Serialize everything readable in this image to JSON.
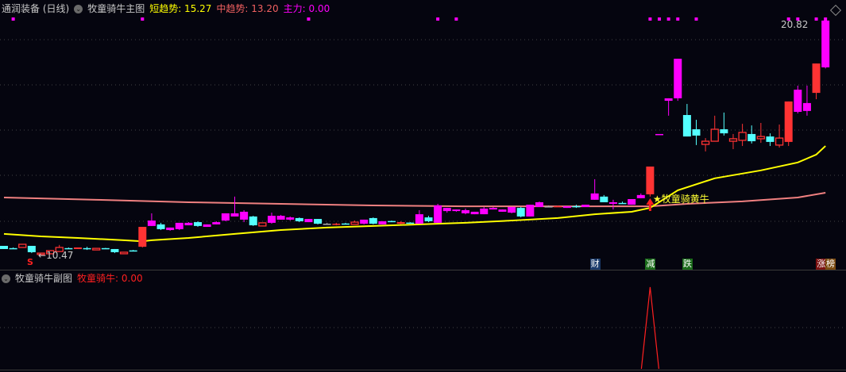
{
  "main_header": {
    "title": "通润装备 (日线)",
    "indicator": "牧童骑牛主图",
    "short_label": "短趋势: 15.27",
    "mid_label": "中趋势: 13.20",
    "main_force_label": "主力: 0.00"
  },
  "sub_header": {
    "indicator": "牧童骑牛副图",
    "value_label": "牧童骑牛: 0.00"
  },
  "annotations": {
    "high_label": "20.82",
    "low_label": "10.47",
    "signal_label": "★牧童骑黄牛",
    "s_mark": "S"
  },
  "tags": [
    {
      "text": "财",
      "index": 64,
      "bg": "#1a3a6a"
    },
    {
      "text": "减",
      "index": 70,
      "bg": "#1a6a1a"
    },
    {
      "text": "跌",
      "index": 74,
      "bg": "#1a6a1a"
    },
    {
      "text": "涨",
      "index": 88.5,
      "bg": "#7a1010"
    },
    {
      "text": "榜",
      "index": 89.5,
      "bg": "#7a4a10"
    }
  ],
  "colors": {
    "up": "#ff3333",
    "down": "#54ffff",
    "hot": "#ff00ff",
    "short_trend": "#ffff00",
    "mid_trend": "#f08080",
    "signal": "#ff2020"
  },
  "chart_data": {
    "type": "candlestick",
    "price_range": [
      10.47,
      20.82
    ],
    "candles": [
      [
        10.85,
        10.71,
        10.85,
        10.71,
        "d"
      ],
      [
        10.75,
        10.74,
        10.78,
        10.72,
        "d"
      ],
      [
        10.78,
        10.92,
        10.92,
        10.78,
        "u"
      ],
      [
        10.85,
        10.57,
        10.85,
        10.53,
        "d"
      ],
      [
        10.47,
        10.53,
        10.53,
        10.47,
        "u"
      ],
      [
        10.5,
        10.64,
        10.64,
        10.5,
        "u"
      ],
      [
        10.6,
        10.78,
        10.89,
        10.6,
        "u"
      ],
      [
        10.75,
        10.74,
        10.78,
        10.71,
        "d"
      ],
      [
        10.71,
        10.78,
        10.78,
        10.71,
        "s"
      ],
      [
        10.75,
        10.74,
        10.81,
        10.67,
        "d"
      ],
      [
        10.67,
        10.74,
        10.74,
        10.67,
        "u"
      ],
      [
        10.75,
        10.74,
        10.76,
        10.73,
        "d"
      ],
      [
        10.71,
        10.57,
        10.71,
        10.53,
        "d"
      ],
      [
        10.5,
        10.57,
        10.57,
        10.5,
        "u"
      ],
      [
        10.65,
        10.64,
        10.67,
        10.62,
        "d"
      ],
      [
        10.81,
        11.69,
        11.69,
        10.78,
        "s"
      ],
      [
        11.73,
        11.97,
        12.29,
        11.73,
        "h"
      ],
      [
        11.8,
        11.59,
        11.87,
        11.55,
        "d"
      ],
      [
        11.55,
        11.66,
        11.66,
        11.52,
        "h"
      ],
      [
        11.59,
        11.87,
        11.87,
        11.55,
        "h"
      ],
      [
        11.76,
        11.87,
        11.9,
        11.76,
        "h"
      ],
      [
        11.9,
        11.73,
        11.94,
        11.69,
        "d"
      ],
      [
        11.69,
        11.8,
        11.8,
        11.69,
        "h"
      ],
      [
        11.8,
        11.9,
        11.94,
        11.8,
        "h"
      ],
      [
        11.97,
        12.29,
        12.29,
        11.94,
        "h"
      ],
      [
        12.15,
        12.29,
        13.03,
        12.15,
        "h"
      ],
      [
        12.01,
        12.36,
        12.43,
        11.9,
        "h"
      ],
      [
        12.15,
        11.76,
        12.18,
        11.73,
        "d"
      ],
      [
        11.73,
        11.87,
        11.87,
        11.73,
        "u"
      ],
      [
        11.87,
        12.18,
        12.32,
        11.83,
        "h"
      ],
      [
        12.01,
        12.18,
        12.22,
        12.01,
        "h"
      ],
      [
        12.01,
        12.11,
        12.15,
        11.97,
        "h"
      ],
      [
        12.08,
        11.94,
        12.11,
        11.9,
        "d"
      ],
      [
        11.9,
        12.04,
        12.04,
        11.9,
        "h"
      ],
      [
        12.04,
        11.83,
        12.04,
        11.8,
        "d"
      ],
      [
        11.83,
        11.83,
        11.87,
        11.8,
        "x"
      ],
      [
        11.8,
        11.83,
        11.87,
        11.76,
        "s"
      ],
      [
        11.84,
        11.83,
        11.87,
        11.8,
        "d"
      ],
      [
        11.8,
        11.9,
        11.97,
        11.8,
        "u"
      ],
      [
        11.83,
        12.01,
        12.01,
        11.8,
        "h"
      ],
      [
        12.08,
        11.83,
        12.11,
        11.8,
        "d"
      ],
      [
        11.8,
        11.94,
        11.94,
        11.8,
        "h"
      ],
      [
        11.95,
        11.94,
        11.97,
        11.9,
        "d"
      ],
      [
        11.83,
        11.9,
        11.94,
        11.8,
        "s"
      ],
      [
        11.88,
        11.87,
        11.9,
        11.83,
        "d"
      ],
      [
        11.83,
        12.25,
        12.43,
        11.83,
        "h"
      ],
      [
        12.11,
        11.94,
        12.18,
        11.9,
        "d"
      ],
      [
        11.87,
        12.64,
        12.71,
        11.87,
        "h"
      ],
      [
        12.39,
        12.53,
        12.53,
        12.32,
        "h"
      ],
      [
        12.39,
        12.46,
        12.46,
        12.36,
        "h"
      ],
      [
        12.29,
        12.43,
        12.5,
        12.25,
        "h"
      ],
      [
        12.25,
        12.36,
        12.36,
        12.25,
        "h"
      ],
      [
        12.25,
        12.5,
        12.57,
        12.25,
        "h"
      ],
      [
        12.46,
        12.53,
        12.57,
        12.46,
        "h"
      ],
      [
        12.36,
        12.46,
        12.46,
        12.36,
        "h"
      ],
      [
        12.32,
        12.57,
        12.57,
        12.29,
        "h"
      ],
      [
        12.53,
        12.15,
        12.57,
        12.11,
        "d"
      ],
      [
        12.15,
        12.67,
        12.67,
        12.15,
        "h"
      ],
      [
        12.57,
        12.78,
        12.81,
        12.57,
        "h"
      ],
      [
        12.6,
        12.6,
        12.64,
        12.57,
        "x"
      ],
      [
        12.58,
        12.61,
        12.64,
        12.57,
        "s"
      ],
      [
        12.53,
        12.6,
        12.6,
        12.53,
        "h"
      ],
      [
        12.61,
        12.6,
        12.67,
        12.53,
        "d"
      ],
      [
        12.57,
        12.67,
        12.67,
        12.57,
        "h"
      ],
      [
        12.89,
        13.17,
        13.8,
        12.89,
        "h"
      ],
      [
        13.03,
        12.78,
        13.1,
        12.78,
        "d"
      ],
      [
        12.71,
        12.78,
        12.89,
        12.46,
        "h"
      ],
      [
        12.75,
        12.74,
        12.81,
        12.71,
        "d"
      ],
      [
        12.67,
        12.92,
        12.92,
        12.67,
        "h"
      ],
      [
        12.96,
        13.1,
        13.17,
        12.96,
        "h"
      ],
      [
        13.13,
        14.36,
        14.36,
        13.03,
        "s"
      ],
      [
        15.8,
        15.8,
        15.8,
        15.8,
        "h"
      ],
      [
        17.27,
        17.38,
        17.38,
        16.61,
        "h"
      ],
      [
        17.38,
        19.13,
        19.13,
        17.27,
        "h"
      ],
      [
        16.64,
        15.69,
        17.13,
        15.69,
        "d"
      ],
      [
        16.01,
        15.73,
        16.43,
        15.31,
        "d"
      ],
      [
        15.34,
        15.48,
        15.62,
        15.03,
        "u"
      ],
      [
        15.48,
        16.01,
        16.61,
        15.48,
        "u"
      ],
      [
        16.01,
        15.83,
        16.75,
        15.73,
        "d"
      ],
      [
        15.48,
        15.59,
        15.8,
        15.13,
        "u"
      ],
      [
        15.52,
        15.87,
        16.25,
        15.27,
        "u"
      ],
      [
        15.8,
        15.48,
        16.18,
        15.38,
        "d"
      ],
      [
        15.59,
        15.69,
        16.29,
        15.41,
        "u"
      ],
      [
        15.69,
        15.45,
        15.83,
        15.27,
        "d"
      ],
      [
        15.31,
        15.62,
        16.22,
        15.2,
        "u"
      ],
      [
        15.45,
        17.24,
        17.24,
        15.27,
        "s"
      ],
      [
        16.78,
        17.76,
        17.94,
        16.71,
        "h"
      ],
      [
        16.82,
        17.17,
        17.94,
        16.61,
        "h"
      ],
      [
        17.62,
        18.92,
        18.92,
        17.34,
        "s"
      ],
      [
        18.75,
        20.82,
        20.82,
        18.7,
        "h"
      ]
    ],
    "short_trend": [
      [
        0,
        11.38
      ],
      [
        4,
        11.27
      ],
      [
        8,
        11.2
      ],
      [
        13,
        11.1
      ],
      [
        15,
        11.05
      ],
      [
        16,
        11.1
      ],
      [
        20,
        11.2
      ],
      [
        25,
        11.38
      ],
      [
        30,
        11.55
      ],
      [
        35,
        11.66
      ],
      [
        40,
        11.73
      ],
      [
        45,
        11.8
      ],
      [
        50,
        11.87
      ],
      [
        55,
        11.97
      ],
      [
        60,
        12.08
      ],
      [
        64,
        12.25
      ],
      [
        68,
        12.36
      ],
      [
        70,
        12.53
      ],
      [
        73,
        13.31
      ],
      [
        77,
        13.84
      ],
      [
        82,
        14.19
      ],
      [
        86,
        14.54
      ],
      [
        88,
        14.89
      ],
      [
        89,
        15.27
      ]
    ],
    "mid_trend": [
      [
        0,
        12.99
      ],
      [
        10,
        12.89
      ],
      [
        20,
        12.78
      ],
      [
        30,
        12.71
      ],
      [
        40,
        12.64
      ],
      [
        50,
        12.6
      ],
      [
        70,
        12.6
      ],
      [
        74,
        12.71
      ],
      [
        80,
        12.82
      ],
      [
        86,
        12.99
      ],
      [
        89,
        13.2
      ]
    ],
    "top_dot_indices": [
      1,
      15,
      33,
      47,
      49,
      70,
      71,
      72,
      73,
      75,
      85,
      86,
      88,
      89
    ],
    "signal_index": 70,
    "sub_signal": {
      "index": 70,
      "value": 1,
      "range": [
        0,
        1
      ]
    }
  }
}
